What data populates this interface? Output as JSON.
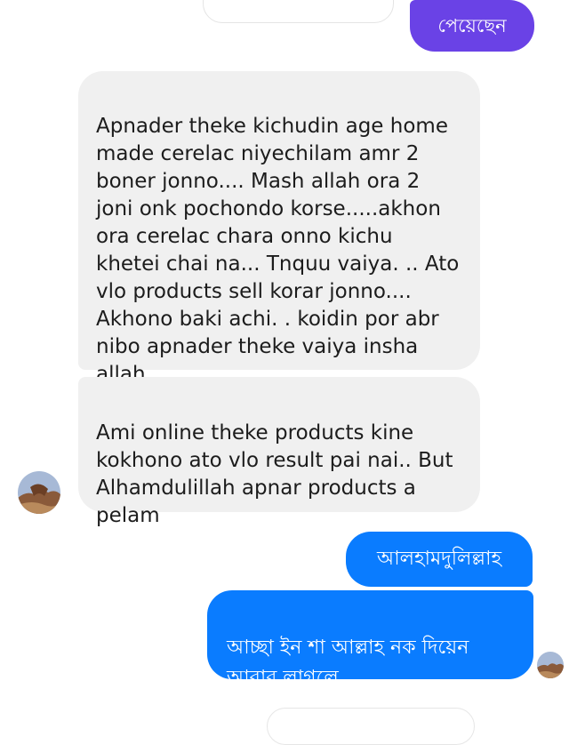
{
  "conversation": {
    "messages": [
      {
        "sender": "them",
        "text": "Apnader theke kichudin age home\nmade cerelac niyechilam amr 2\nboner jonno.... Mash allah ora 2\njoni onk pochondo korse.....akhon\nora cerelac chara onno kichu\nkhetei chai na... Tnquu vaiya. .. Ato\nvlo products sell korar jonno....\nAkhono baki achi. . koidin por abr\nnibo apnader theke vaiya insha\nallah"
      },
      {
        "sender": "them",
        "text": "Ami online theke products kine\nkokhono ato vlo result pai nai.. But\nAlhamdulillah apnar products a\npelam"
      },
      {
        "sender": "me",
        "text": "আলহামদুলিল্লাহ"
      },
      {
        "sender": "me",
        "text": "আচ্ছা ইন শা আল্লাহ নক দিয়েন\nআবার লাগলে"
      }
    ],
    "top_partial": {
      "sender": "me",
      "text": "পেয়েছেন"
    }
  },
  "colors": {
    "received_bubble": "#f0f0f0",
    "sent_purple": "#6a42e6",
    "sent_blue": "#0a7cff"
  },
  "icons": {
    "avatar_left": "contact-avatar",
    "avatar_right": "read-receipt-avatar"
  }
}
